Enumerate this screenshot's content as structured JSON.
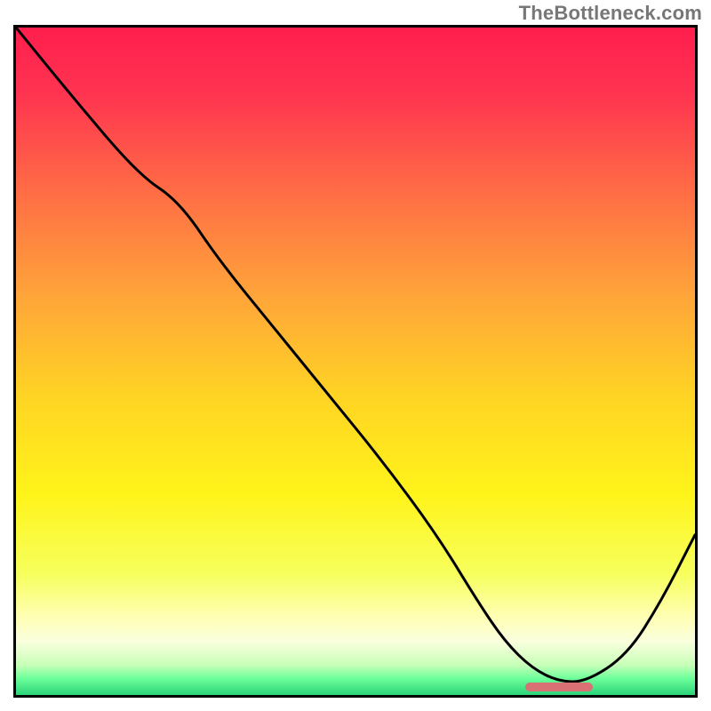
{
  "watermark": "TheBottleneck.com",
  "chart_data": {
    "type": "line",
    "title": "",
    "xlabel": "",
    "ylabel": "",
    "xlim": [
      0,
      100
    ],
    "ylim": [
      0,
      100
    ],
    "grid": false,
    "series": [
      {
        "name": "curve",
        "x": [
          0,
          8,
          18,
          24,
          30,
          38,
          46,
          54,
          62,
          68,
          72,
          76,
          80,
          84,
          90,
          95,
          100
        ],
        "values": [
          100,
          90,
          78,
          74,
          65,
          55,
          45,
          35,
          24,
          14,
          8,
          4,
          2,
          2,
          6,
          14,
          24
        ]
      }
    ],
    "marker": {
      "x_start": 75,
      "x_end": 85,
      "y": 1.2
    },
    "gradient_stops": [
      {
        "offset": 0.0,
        "color": "#ff1e4e"
      },
      {
        "offset": 0.1,
        "color": "#ff3450"
      },
      {
        "offset": 0.25,
        "color": "#ff6e45"
      },
      {
        "offset": 0.4,
        "color": "#ffa43a"
      },
      {
        "offset": 0.55,
        "color": "#ffd324"
      },
      {
        "offset": 0.7,
        "color": "#fff41a"
      },
      {
        "offset": 0.82,
        "color": "#f6ff5e"
      },
      {
        "offset": 0.88,
        "color": "#ffffb0"
      },
      {
        "offset": 0.92,
        "color": "#faffde"
      },
      {
        "offset": 0.955,
        "color": "#c7ffb8"
      },
      {
        "offset": 0.975,
        "color": "#6eff9a"
      },
      {
        "offset": 1.0,
        "color": "#2bd47a"
      }
    ]
  }
}
